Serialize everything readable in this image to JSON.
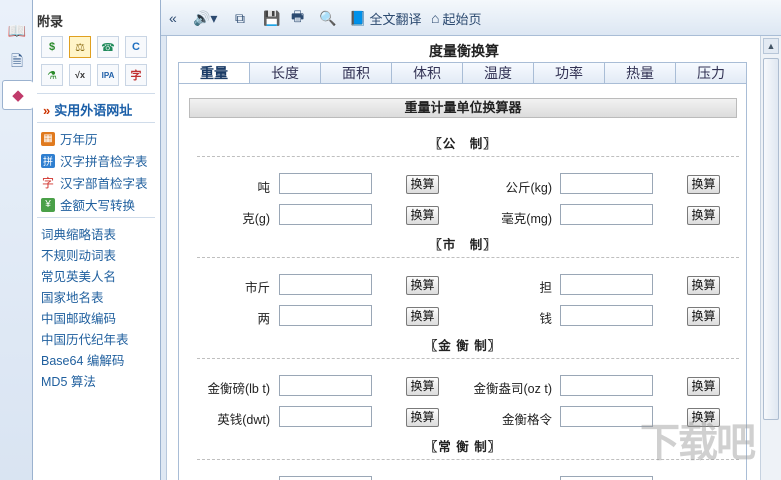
{
  "sidebar": {
    "header": "附录",
    "tools": [
      {
        "icon": "currency-icon",
        "glyph": "$"
      },
      {
        "icon": "scale-icon",
        "glyph": "⚖"
      },
      {
        "icon": "phone-icon",
        "glyph": "☎"
      },
      {
        "icon": "refresh-icon",
        "glyph": "C"
      },
      {
        "icon": "flask-icon",
        "glyph": "⚗"
      },
      {
        "icon": "sqrt-icon",
        "glyph": "√x"
      },
      {
        "icon": "ipa-icon",
        "glyph": "IPA"
      },
      {
        "icon": "rune-icon",
        "glyph": "字"
      }
    ],
    "highlight_link": "实用外语网址",
    "icon_links": [
      "万年历",
      "汉字拼音检字表",
      "汉字部首检字表",
      "金额大写转换"
    ],
    "links": [
      "词典缩略语表",
      "不规则动词表",
      "常见英美人名",
      "国家地名表",
      "中国邮政编码",
      "中国历代纪年表",
      "Base64 编解码",
      "MD5 算法"
    ]
  },
  "toolbar": {
    "full_translate": "全文翻译",
    "home": "起始页"
  },
  "main": {
    "title": "度量衡换算",
    "tabs": [
      "重量",
      "长度",
      "面积",
      "体积",
      "温度",
      "功率",
      "热量",
      "压力"
    ],
    "active_tab": "重量",
    "panel_title": "重量计量单位换算器",
    "button_label": "换算",
    "sections": [
      {
        "title": "〖公　制〗",
        "rows": [
          [
            "吨",
            "公斤(kg)"
          ],
          [
            "克(g)",
            "毫克(mg)"
          ]
        ]
      },
      {
        "title": "〖市　制〗",
        "rows": [
          [
            "市斤",
            "担"
          ],
          [
            "两",
            "钱"
          ]
        ]
      },
      {
        "title": "〖金 衡 制〗",
        "rows": [
          [
            "金衡磅(lb t)",
            "金衡盎司(oz t)"
          ],
          [
            "英钱(dwt)",
            "金衡格令"
          ]
        ]
      },
      {
        "title": "〖常 衡 制〗",
        "rows": []
      }
    ]
  }
}
